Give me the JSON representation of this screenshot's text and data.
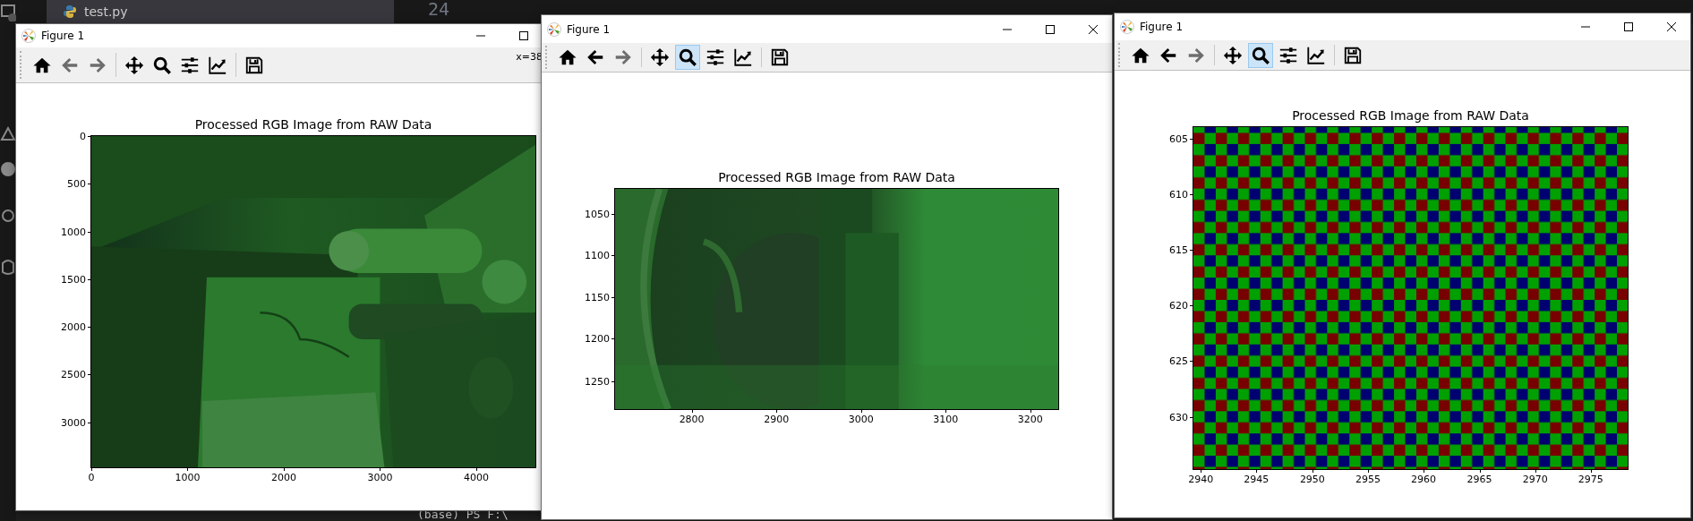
{
  "desktop": {
    "editor_tab": "test.py",
    "line_number": "24",
    "terminal_text": "(base) PS F:\\"
  },
  "windows": [
    {
      "title": "Figure 1",
      "controls": [
        {
          "kind": "minimize"
        },
        {
          "kind": "maximize"
        }
      ],
      "tools": [
        {
          "kind": "home",
          "disabled": false,
          "selected": false
        },
        {
          "kind": "back",
          "disabled": true,
          "selected": false
        },
        {
          "kind": "forward",
          "disabled": true,
          "selected": false
        },
        {
          "kind": "pan",
          "disabled": false,
          "selected": false
        },
        {
          "kind": "zoom",
          "disabled": false,
          "selected": false
        },
        {
          "kind": "subplots",
          "disabled": false,
          "selected": false
        },
        {
          "kind": "axes",
          "disabled": false,
          "selected": false
        },
        {
          "kind": "save",
          "disabled": false,
          "selected": false
        }
      ],
      "readout": "x=38",
      "axes": {
        "title": "Processed RGB Image from RAW Data",
        "kind": "picture",
        "xticks": [
          "0",
          "1000",
          "2000",
          "3000",
          "4000"
        ],
        "yticks": [
          "0",
          "500",
          "1000",
          "1500",
          "2000",
          "2500",
          "3000"
        ]
      }
    },
    {
      "title": "Figure 1",
      "controls": [
        {
          "kind": "minimize"
        },
        {
          "kind": "maximize"
        },
        {
          "kind": "close"
        }
      ],
      "tools": [
        {
          "kind": "home",
          "disabled": false,
          "selected": false
        },
        {
          "kind": "back",
          "disabled": false,
          "selected": false
        },
        {
          "kind": "forward",
          "disabled": true,
          "selected": false
        },
        {
          "kind": "pan",
          "disabled": false,
          "selected": false
        },
        {
          "kind": "zoom",
          "disabled": false,
          "selected": true
        },
        {
          "kind": "subplots",
          "disabled": false,
          "selected": false
        },
        {
          "kind": "axes",
          "disabled": false,
          "selected": false
        },
        {
          "kind": "save",
          "disabled": false,
          "selected": false
        }
      ],
      "axes": {
        "title": "Processed RGB Image from RAW Data",
        "kind": "picture",
        "xticks": [
          "2800",
          "2900",
          "3000",
          "3100",
          "3200"
        ],
        "yticks": [
          "1050",
          "1100",
          "1150",
          "1200",
          "1250"
        ]
      }
    },
    {
      "title": "Figure 1",
      "controls": [
        {
          "kind": "minimize"
        },
        {
          "kind": "maximize"
        },
        {
          "kind": "close"
        }
      ],
      "tools": [
        {
          "kind": "home",
          "disabled": false,
          "selected": false
        },
        {
          "kind": "back",
          "disabled": false,
          "selected": false
        },
        {
          "kind": "forward",
          "disabled": true,
          "selected": false
        },
        {
          "kind": "pan",
          "disabled": false,
          "selected": false
        },
        {
          "kind": "zoom",
          "disabled": false,
          "selected": true
        },
        {
          "kind": "subplots",
          "disabled": false,
          "selected": false
        },
        {
          "kind": "axes",
          "disabled": false,
          "selected": false
        },
        {
          "kind": "save",
          "disabled": false,
          "selected": false
        }
      ],
      "axes": {
        "title": "Processed RGB Image from RAW Data",
        "kind": "mosaic",
        "xticks": [
          "2940",
          "2945",
          "2950",
          "2955",
          "2960",
          "2965",
          "2970",
          "2975"
        ],
        "yticks": [
          "605",
          "610",
          "615",
          "620",
          "625",
          "630"
        ]
      }
    }
  ]
}
